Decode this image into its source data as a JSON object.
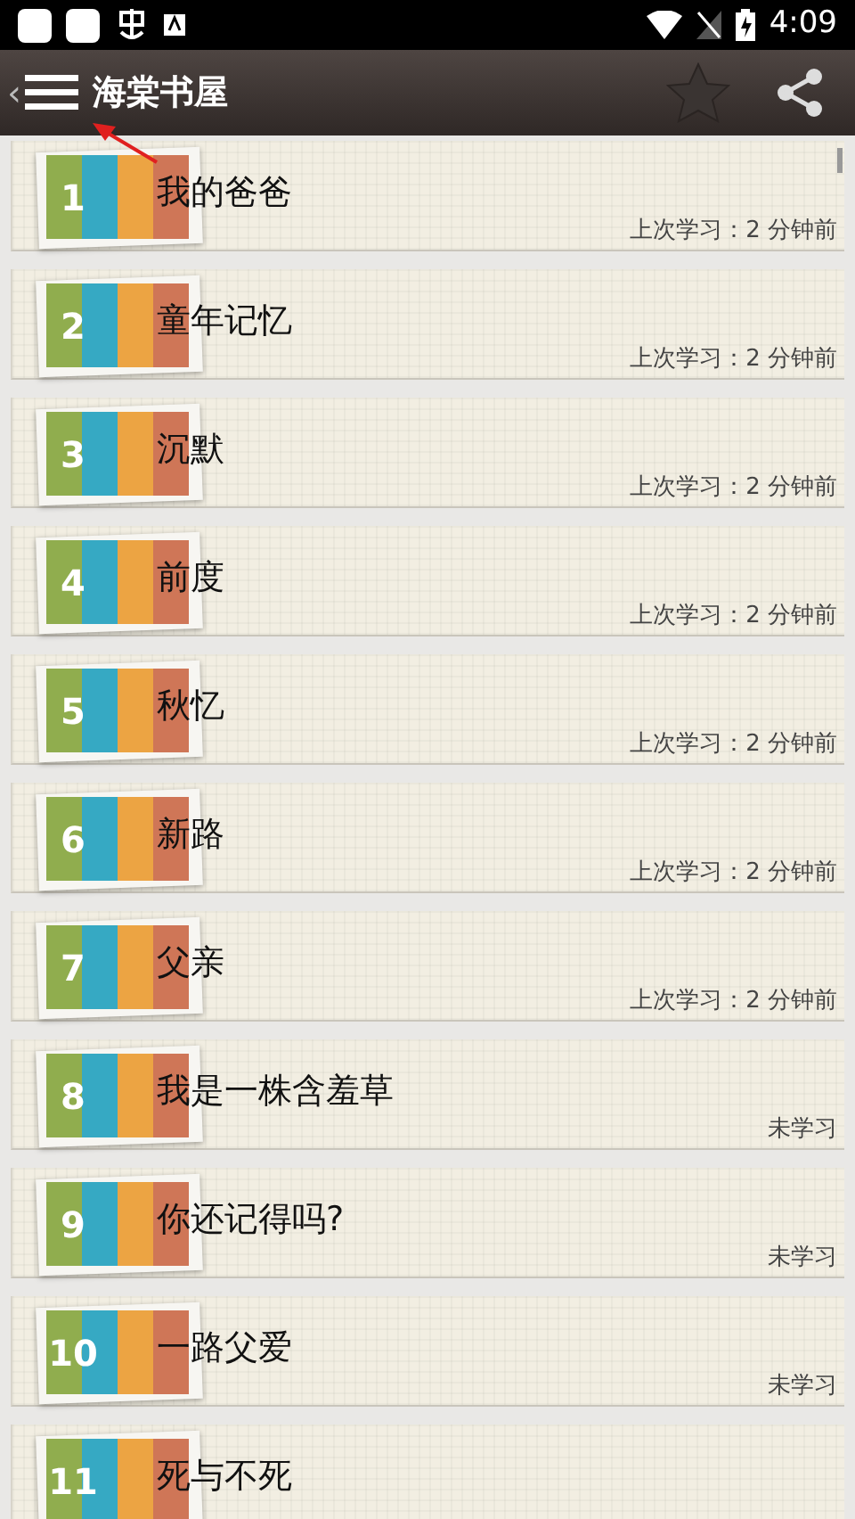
{
  "status_bar": {
    "time": "4:09"
  },
  "toolbar": {
    "back": "‹",
    "title": "海棠书屋"
  },
  "lessons": [
    {
      "number": "1",
      "title": "我的爸爸",
      "status": "上次学习：2 分钟前"
    },
    {
      "number": "2",
      "title": "童年记忆",
      "status": "上次学习：2 分钟前"
    },
    {
      "number": "3",
      "title": "沉默",
      "status": "上次学习：2 分钟前"
    },
    {
      "number": "4",
      "title": "前度",
      "status": "上次学习：2 分钟前"
    },
    {
      "number": "5",
      "title": "秋忆",
      "status": "上次学习：2 分钟前"
    },
    {
      "number": "6",
      "title": "新路",
      "status": "上次学习：2 分钟前"
    },
    {
      "number": "7",
      "title": "父亲",
      "status": "上次学习：2 分钟前"
    },
    {
      "number": "8",
      "title": "我是一株含羞草",
      "status": "未学习"
    },
    {
      "number": "9",
      "title": "你还记得吗?",
      "status": "未学习"
    },
    {
      "number": "10",
      "title": "一路父爱",
      "status": "未学习"
    },
    {
      "number": "11",
      "title": "死与不死"
    }
  ]
}
